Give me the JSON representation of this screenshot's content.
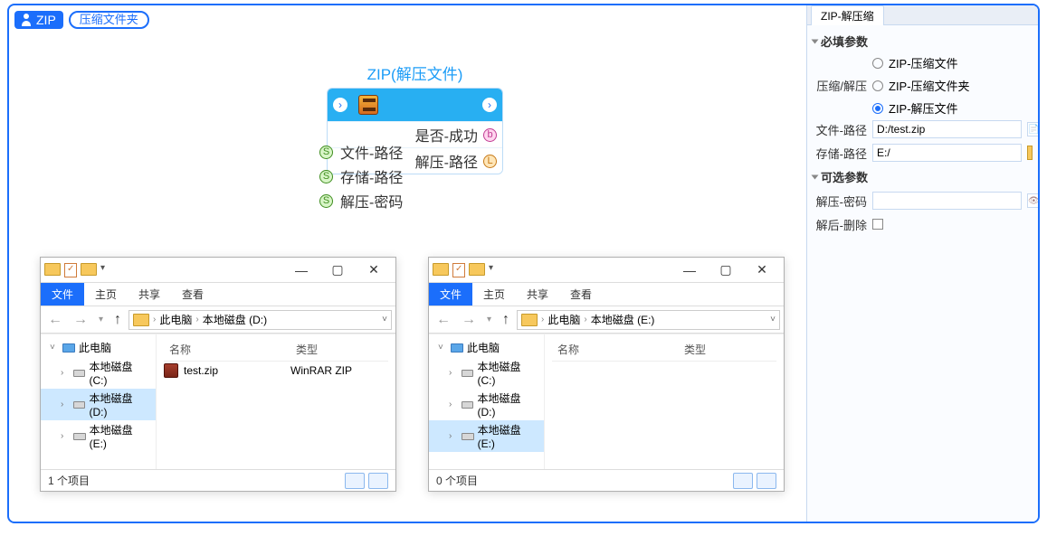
{
  "header": {
    "zip": "ZIP",
    "folder_chip": "压缩文件夹"
  },
  "node": {
    "title": "ZIP(解压文件)",
    "out1": "是否-成功",
    "out2": "解压-路径",
    "in1": "文件-路径",
    "in2": "存储-路径",
    "in3": "解压-密码"
  },
  "panel": {
    "tab": "ZIP-解压缩",
    "section_required": "必填参数",
    "mode_label": "压缩/解压",
    "mode_opt1": "ZIP-压缩文件",
    "mode_opt2": "ZIP-压缩文件夹",
    "mode_opt3": "ZIP-解压文件",
    "file_path_label": "文件-路径",
    "file_path_value": "D:/test.zip",
    "store_path_label": "存储-路径",
    "store_path_value": "E:/",
    "section_optional": "可选参数",
    "password_label": "解压-密码",
    "password_value": "",
    "delete_label": "解后-删除"
  },
  "explorer_left": {
    "ribbon": {
      "file": "文件",
      "home": "主页",
      "share": "共享",
      "view": "查看"
    },
    "addr": {
      "root": "此电脑",
      "path": "本地磁盘 (D:)"
    },
    "tree": {
      "root": "此电脑",
      "c": "本地磁盘 (C:)",
      "d": "本地磁盘 (D:)",
      "e": "本地磁盘 (E:)"
    },
    "cols": {
      "name": "名称",
      "type": "类型"
    },
    "files": [
      {
        "name": "test.zip",
        "type": "WinRAR ZIP"
      }
    ],
    "status": "1 个项目"
  },
  "explorer_right": {
    "ribbon": {
      "file": "文件",
      "home": "主页",
      "share": "共享",
      "view": "查看"
    },
    "addr": {
      "root": "此电脑",
      "path": "本地磁盘 (E:)"
    },
    "tree": {
      "root": "此电脑",
      "c": "本地磁盘 (C:)",
      "d": "本地磁盘 (D:)",
      "e": "本地磁盘 (E:)"
    },
    "cols": {
      "name": "名称",
      "type": "类型"
    },
    "files": [],
    "status": "0 个项目"
  }
}
